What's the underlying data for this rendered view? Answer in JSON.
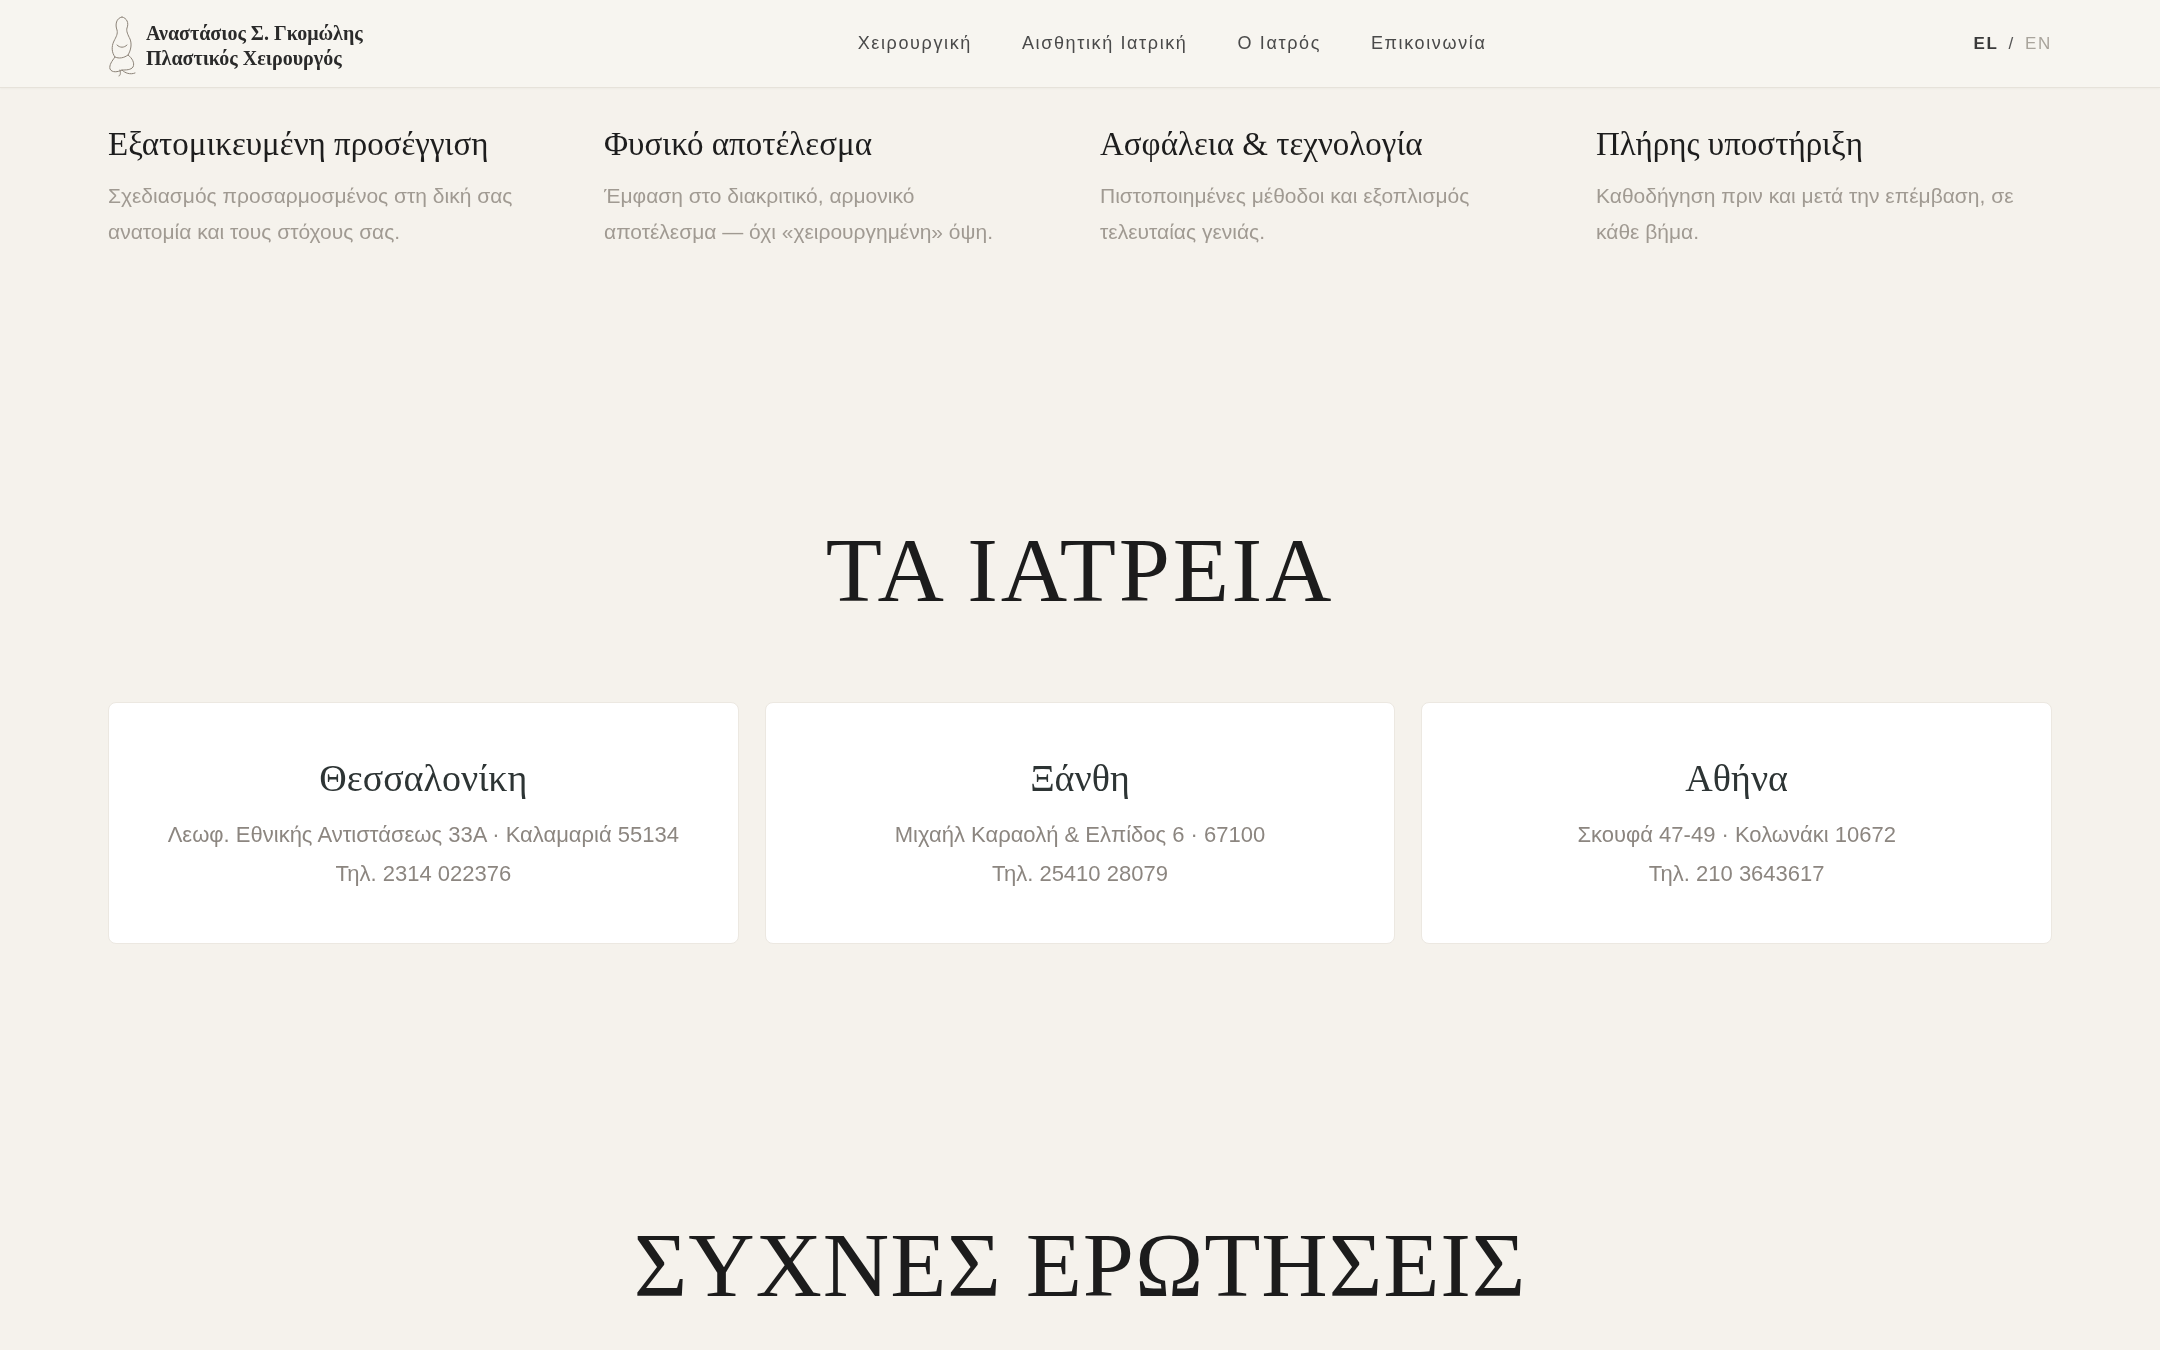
{
  "header": {
    "logo": {
      "lines": [
        "Αναστάσιος Σ. Γκομώλης",
        "Πλαστικός Χειρουργός"
      ]
    },
    "nav": [
      "Χειρουργική",
      "Αισθητική Ιατρική",
      "Ο Ιατρός",
      "Επικοινωνία"
    ],
    "languages": [
      {
        "label": "EL",
        "selected": true
      },
      {
        "label": "EN",
        "selected": false
      }
    ],
    "language_separator": "/"
  },
  "features": [
    {
      "title": "Εξατομικευμένη προσέγγιση",
      "text": "Σχεδιασμός προσαρμοσμένος στη δική σας ανατομία και τους στόχους σας."
    },
    {
      "title": "Φυσικό αποτέλεσμα",
      "text": "Έμφαση στο διακριτικό, αρμονικό αποτέλεσμα — όχι «χειρουργημένη» όψη."
    },
    {
      "title": "Ασφάλεια & τεχνολογία",
      "text": "Πιστοποιημένες μέθοδοι και εξοπλισμός τελευταίας γενιάς."
    },
    {
      "title": "Πλήρης υποστήριξη",
      "text": "Καθοδήγηση πριν και μετά την επέμβαση, σε κάθε βήμα."
    }
  ],
  "clinics": {
    "title": "ΤΑ ΙΑΤΡΕΙΑ",
    "cards": [
      {
        "city": "Θεσσαλονίκη",
        "address": "Λεωφ. Εθνικής Αντιστάσεως 33Α · Καλαμαριά 55134",
        "phone": "Τηλ. 2314 022376"
      },
      {
        "city": "Ξάνθη",
        "address": "Μιχαήλ Καραολή & Ελπίδος 6 · 67100",
        "phone": "Τηλ. 25410 28079"
      },
      {
        "city": "Αθήνα",
        "address": "Σκουφά 47-49 · Κολωνάκι 10672",
        "phone": "Τηλ. 210 3643617"
      }
    ]
  },
  "faq": {
    "title": "ΣΥΧΝΕΣ ΕΡΩΤΗΣΕΙΣ"
  }
}
